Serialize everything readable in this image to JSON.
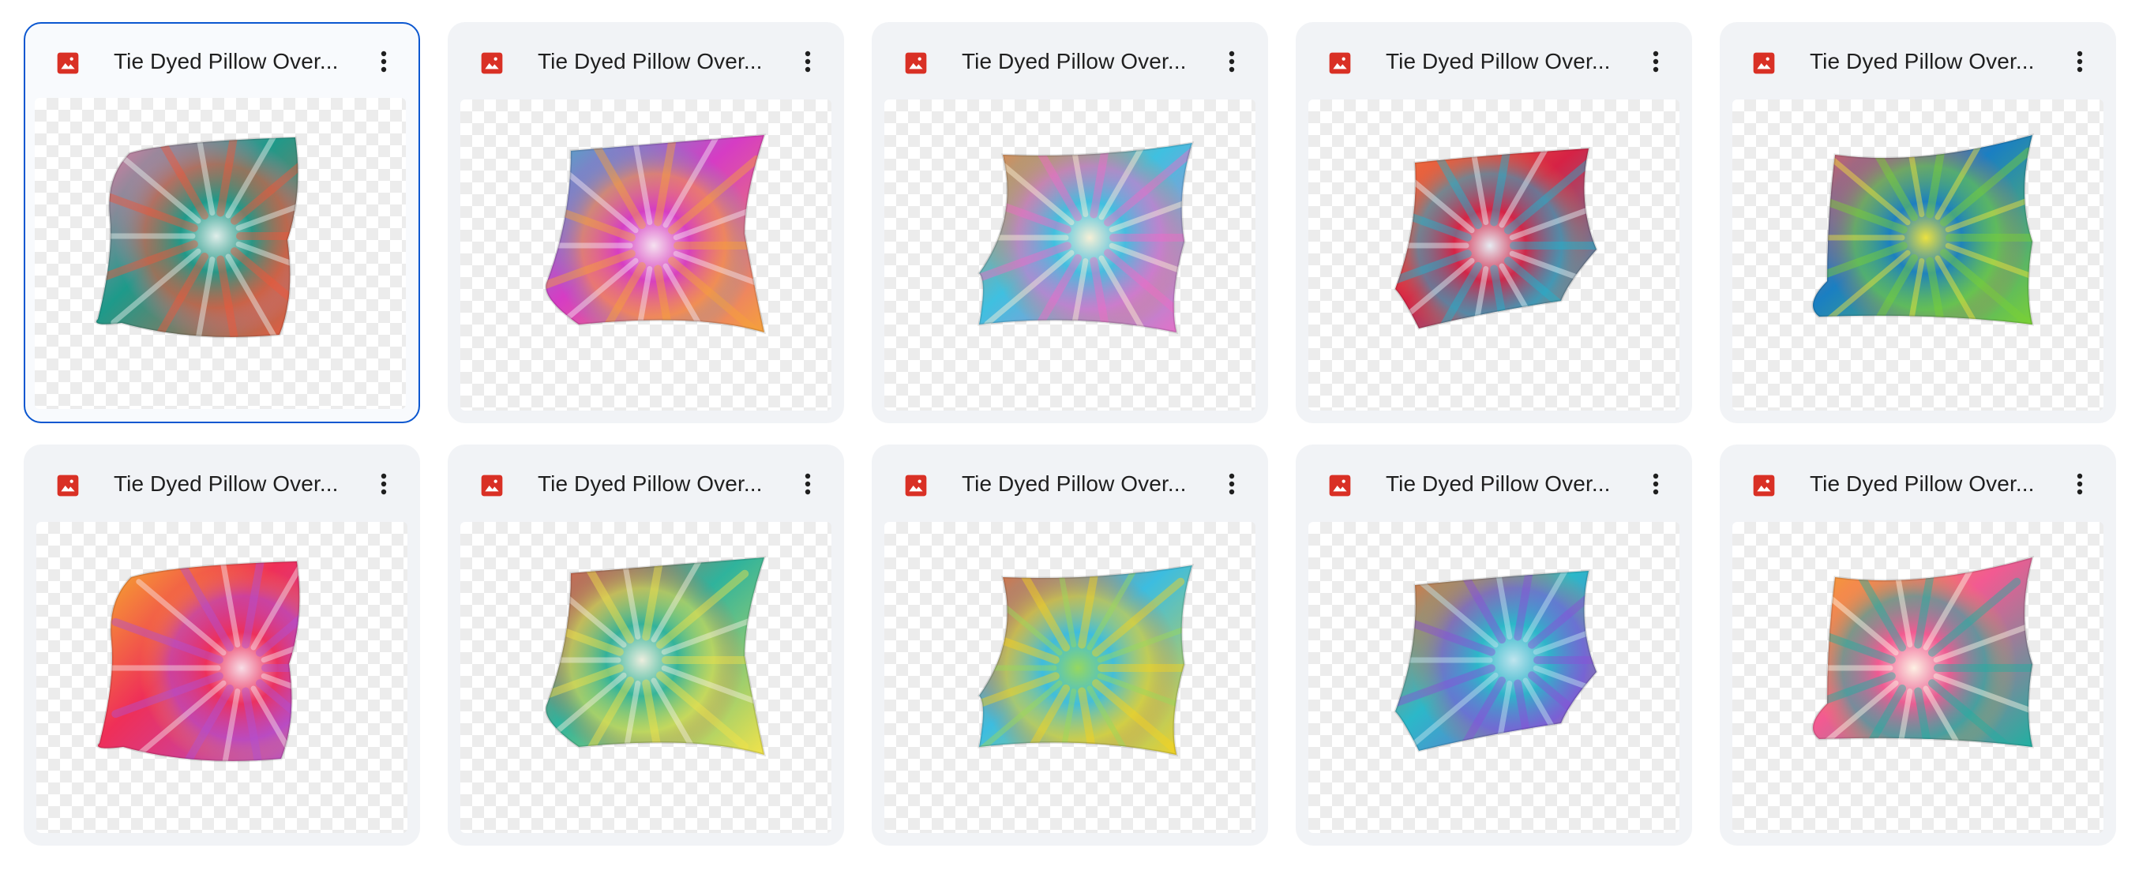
{
  "files": [
    {
      "name": "Tie Dyed Pillow Over...",
      "selected": true,
      "file_type": "image-icon",
      "menu_icon": "more-vert-icon",
      "colors": [
        "#1d9a8a",
        "#f0573a",
        "#f47aa8",
        "#e8f3f0"
      ]
    },
    {
      "name": "Tie Dyed Pillow Over...",
      "selected": false,
      "file_type": "image-icon",
      "menu_icon": "more-vert-icon",
      "colors": [
        "#d63cc4",
        "#f6a13a",
        "#3fb4c9",
        "#f7e9f3"
      ]
    },
    {
      "name": "Tie Dyed Pillow Over...",
      "selected": false,
      "file_type": "image-icon",
      "menu_icon": "more-vert-icon",
      "colors": [
        "#3fc0e0",
        "#f06bc6",
        "#f7823a",
        "#fff3d6"
      ]
    },
    {
      "name": "Tie Dyed Pillow Over...",
      "selected": false,
      "file_type": "image-icon",
      "menu_icon": "more-vert-icon",
      "colors": [
        "#d62245",
        "#1fb4cf",
        "#f07a3a",
        "#e8f6fb"
      ]
    },
    {
      "name": "Tie Dyed Pillow Over...",
      "selected": false,
      "file_type": "image-icon",
      "menu_icon": "more-vert-icon",
      "colors": [
        "#1a7fc2",
        "#7ad136",
        "#f25a5a",
        "#f6e63a"
      ]
    },
    {
      "name": "Tie Dyed Pillow Over...",
      "selected": false,
      "file_type": "image-icon",
      "menu_icon": "more-vert-icon",
      "colors": [
        "#ef2f58",
        "#b24fd0",
        "#f7b22a",
        "#f9e6ec"
      ]
    },
    {
      "name": "Tie Dyed Pillow Over...",
      "selected": false,
      "file_type": "image-icon",
      "menu_icon": "more-vert-icon",
      "colors": [
        "#2fb39c",
        "#f2e34a",
        "#f2573f",
        "#f6f1e2"
      ]
    },
    {
      "name": "Tie Dyed Pillow Over...",
      "selected": false,
      "file_type": "image-icon",
      "menu_icon": "more-vert-icon",
      "colors": [
        "#3cbde0",
        "#f7d21f",
        "#f2662c",
        "#9ad95a"
      ]
    },
    {
      "name": "Tie Dyed Pillow Over...",
      "selected": false,
      "file_type": "image-icon",
      "menu_icon": "more-vert-icon",
      "colors": [
        "#2bb8c9",
        "#8a4fd6",
        "#f07030",
        "#c6e8f0"
      ]
    },
    {
      "name": "Tie Dyed Pillow Over...",
      "selected": false,
      "file_type": "image-icon",
      "menu_icon": "more-vert-icon",
      "colors": [
        "#f25a92",
        "#1fb0a2",
        "#f5a623",
        "#fff8e8"
      ]
    }
  ],
  "theme": {
    "card_bg": "#f1f3f6",
    "selected_border": "#0b57d0",
    "image_icon_color": "#d93025",
    "text_color": "#1f1f1f"
  }
}
